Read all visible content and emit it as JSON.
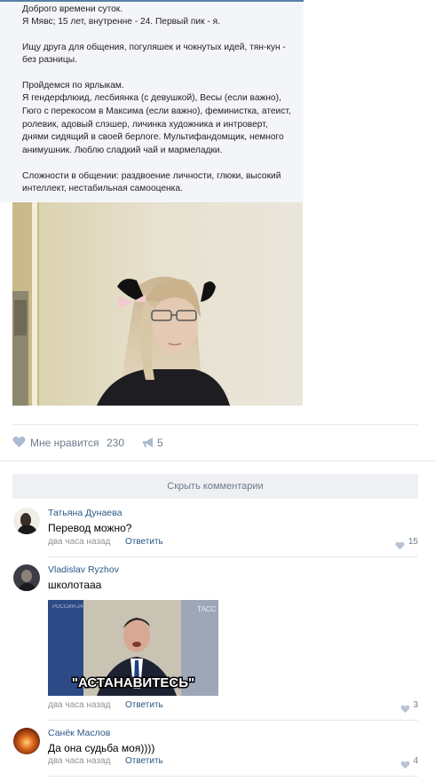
{
  "post": {
    "lines": [
      "Доброго времени суток.",
      "Я Мявс; 15 лет, внутренне - 24. Первый пик - я.",
      "",
      "Ищу друга для общения, погуляшек и чокнутых идей, тян-кун -",
      "без разницы.",
      "",
      "Пройдемся по ярлыкам.",
      "Я гендерфлюид, лесбиянка (с девушкой), Весы (если важно),",
      "Гюго с перекосом в Максима (если важно), феминистка, атеист,",
      "ролевик, адовый слэшер, личинка художника и интроверт,",
      "днями сидящий в своей берлоге. Мультифандомщик, немного",
      "анимушник. Люблю сладкий чай и мармеладки.",
      "",
      "Сложности в общении: раздвоение личности, глюки, высокий",
      "интеллект, нестабильная самооценка."
    ],
    "like_label": "Мне нравится",
    "like_count": "230",
    "share_count": "5",
    "photo_icon": "girl-with-cat-ears-photo"
  },
  "comments_toggle": "Скрыть комментарии",
  "comments": [
    {
      "author": "Татьяна Дунаева",
      "text": "Перевод можно?",
      "time": "два часа назад",
      "reply": "Ответить",
      "likes": "15"
    },
    {
      "author": "Vladislav Ryzhov",
      "text": "школотааа",
      "time": "два часа назад",
      "reply": "Ответить",
      "likes": "3",
      "meme_caption": "\"АСТАНАВИТЕСЬ\"",
      "meme_logo": "ТАСС"
    },
    {
      "author": "Санёк Маслов",
      "text": "Да она судьба моя))))",
      "time": "два часа назад",
      "reply": "Ответить",
      "likes": "4"
    }
  ],
  "colors": {
    "link": "#2a5885",
    "muted": "#939393",
    "accent": "#5b7fa6"
  }
}
